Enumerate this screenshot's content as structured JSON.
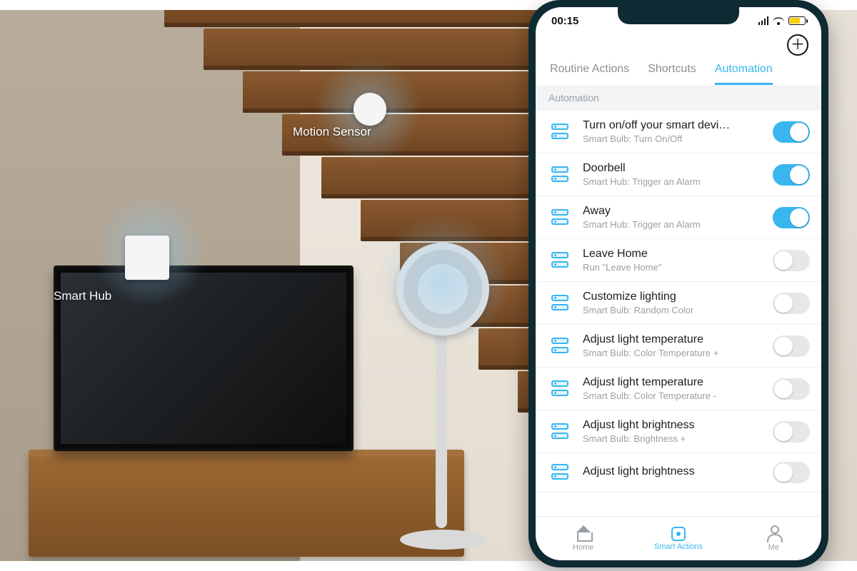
{
  "scene": {
    "callouts": {
      "hub": "Smart Hub",
      "motion": "Motion Sensor"
    }
  },
  "status": {
    "time": "00:15"
  },
  "header": {
    "add_icon_name": "plus-icon"
  },
  "tabs": {
    "items": [
      {
        "label": "Routine Actions",
        "active": false
      },
      {
        "label": "Shortcuts",
        "active": false
      },
      {
        "label": "Automation",
        "active": true
      }
    ]
  },
  "section_label": "Automation",
  "automations": [
    {
      "title": "Turn on/off your smart devi…",
      "subtitle": "Smart Bulb: Turn On/Off",
      "enabled": true
    },
    {
      "title": "Doorbell",
      "subtitle": "Smart Hub: Trigger an Alarm",
      "enabled": true
    },
    {
      "title": "Away",
      "subtitle": "Smart Hub: Trigger an Alarm",
      "enabled": true
    },
    {
      "title": "Leave Home",
      "subtitle": "Run \"Leave Home\"",
      "enabled": false
    },
    {
      "title": "Customize lighting",
      "subtitle": "Smart Bulb: Random Color",
      "enabled": false
    },
    {
      "title": "Adjust light temperature",
      "subtitle": "Smart Bulb: Color Temperature +",
      "enabled": false
    },
    {
      "title": "Adjust light temperature",
      "subtitle": "Smart Bulb: Color Temperature -",
      "enabled": false
    },
    {
      "title": "Adjust light brightness",
      "subtitle": "Smart Bulb: Brightness +",
      "enabled": false
    },
    {
      "title": "Adjust light brightness",
      "subtitle": "",
      "enabled": false
    }
  ],
  "bottom_nav": {
    "items": [
      {
        "label": "Home",
        "active": false
      },
      {
        "label": "Smart Actions",
        "active": true
      },
      {
        "label": "Me",
        "active": false
      }
    ]
  },
  "colors": {
    "accent": "#39b6ef"
  }
}
